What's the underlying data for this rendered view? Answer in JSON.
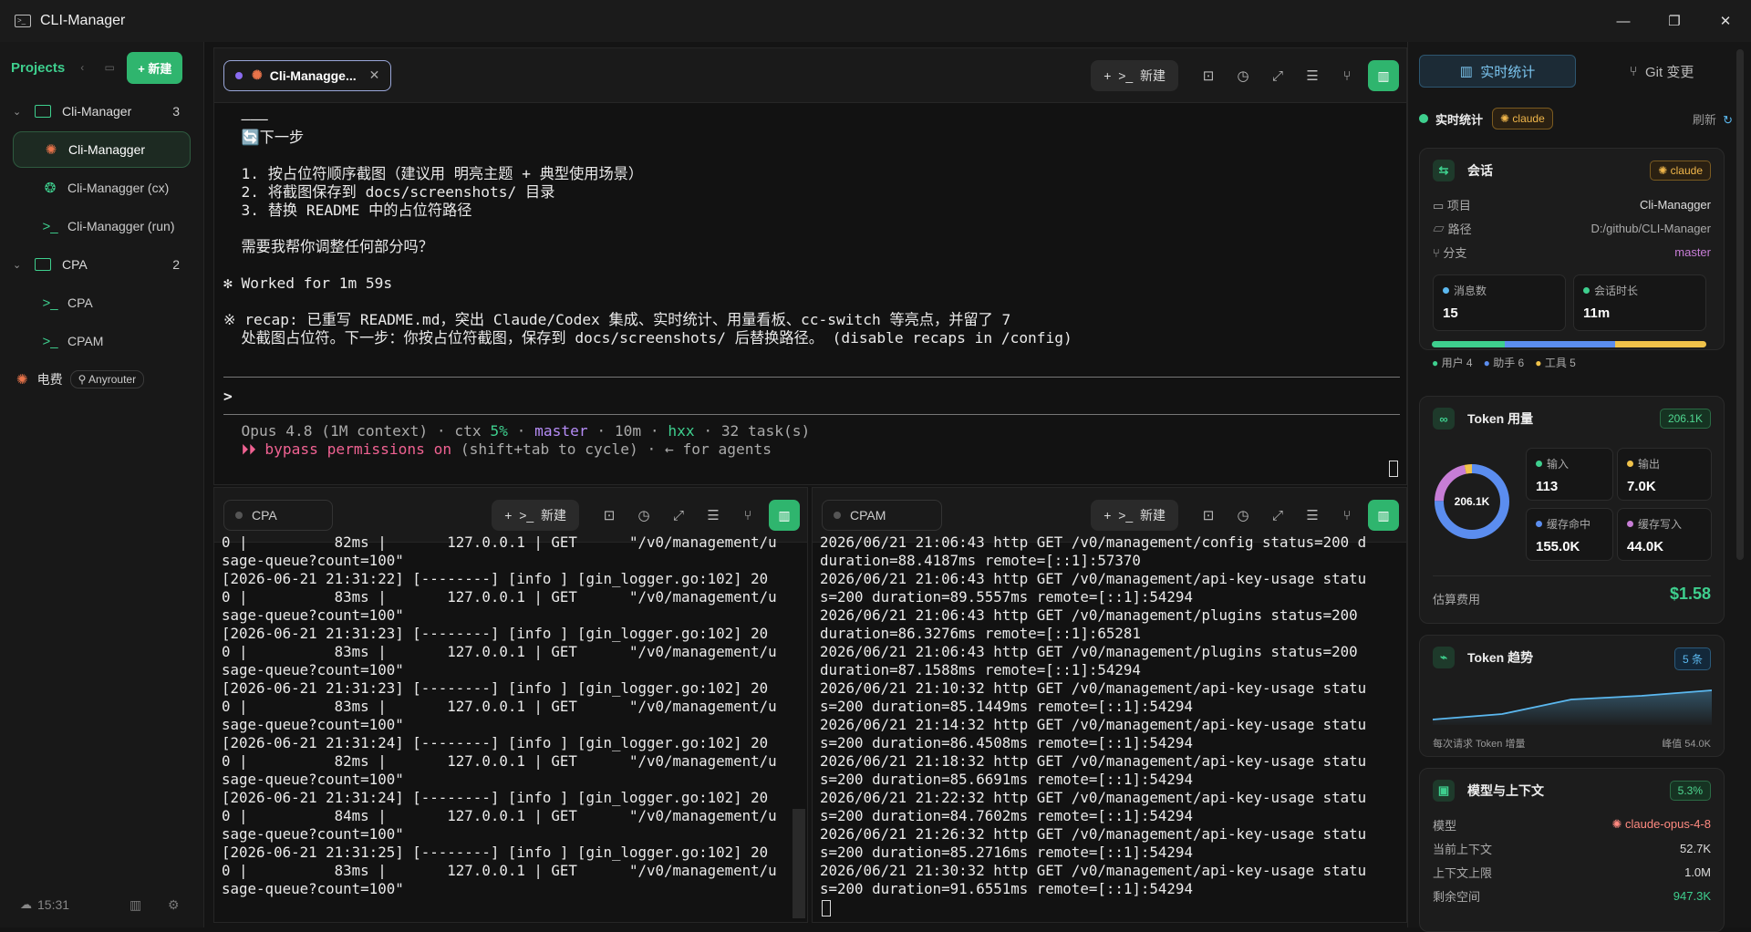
{
  "app": {
    "title": "CLI-Manager"
  },
  "sidebar": {
    "header_label": "Projects",
    "new_label": "+ 新建",
    "groups": [
      {
        "name": "Cli-Manager",
        "count": "3"
      },
      {
        "name": "CPA",
        "count": "2"
      }
    ],
    "items": [
      {
        "label": "Cli-Managger",
        "icon": "claude-icon"
      },
      {
        "label": "Cli-Managger (cx)",
        "icon": "openai-icon"
      },
      {
        "label": "Cli-Managger (run)",
        "icon": "terminal-icon"
      },
      {
        "label": "CPA",
        "icon": "terminal-icon"
      },
      {
        "label": "CPAM",
        "icon": "terminal-icon"
      }
    ],
    "extra_item": {
      "label": "电费",
      "tag": "Anyrouter"
    },
    "footer_time": "15:31"
  },
  "main_pane": {
    "tab_label": "Cli-Managge...",
    "new_label": "新建",
    "lines": [
      "  ———",
      "  🔄下一步",
      "",
      "  1. 按占位符顺序截图（建议用 明亮主题 + 典型使用场景）",
      "  2. 将截图保存到 docs/screenshots/ 目录",
      "  3. 替换 README 中的占位符路径",
      "",
      "  需要我帮你调整任何部分吗？",
      "",
      "✻ Worked for 1m 59s",
      "",
      "※ recap: 已重写 README.md，突出 Claude/Codex 集成、实时统计、用量看板、cc-switch 等亮点，并留了 7",
      "  处截图占位符。下一步：你按占位符截图，保存到 docs/screenshots/ 后替换路径。 (disable recaps in /config)"
    ],
    "prompt": ">",
    "status_line": "  Opus 4.8 (1M context) · ctx 5% · master · 10m · hxx · 32 task(s)",
    "bypass_line": "  ⏵⏵ bypass permissions on (shift+tab to cycle) · ← for agents"
  },
  "cpa_pane": {
    "tab_label": "CPA",
    "new_label": "新建",
    "lines": [
      "0 |          82ms |       127.0.0.1 | GET      \"/v0/management/u",
      "sage-queue?count=100\"",
      "[2026-06-21 21:31:22] [--------] [info ] [gin_logger.go:102] 20",
      "0 |          83ms |       127.0.0.1 | GET      \"/v0/management/u",
      "sage-queue?count=100\"",
      "[2026-06-21 21:31:23] [--------] [info ] [gin_logger.go:102] 20",
      "0 |          83ms |       127.0.0.1 | GET      \"/v0/management/u",
      "sage-queue?count=100\"",
      "[2026-06-21 21:31:23] [--------] [info ] [gin_logger.go:102] 20",
      "0 |          83ms |       127.0.0.1 | GET      \"/v0/management/u",
      "sage-queue?count=100\"",
      "[2026-06-21 21:31:24] [--------] [info ] [gin_logger.go:102] 20",
      "0 |          82ms |       127.0.0.1 | GET      \"/v0/management/u",
      "sage-queue?count=100\"",
      "[2026-06-21 21:31:24] [--------] [info ] [gin_logger.go:102] 20",
      "0 |          84ms |       127.0.0.1 | GET      \"/v0/management/u",
      "sage-queue?count=100\"",
      "[2026-06-21 21:31:25] [--------] [info ] [gin_logger.go:102] 20",
      "0 |          83ms |       127.0.0.1 | GET      \"/v0/management/u",
      "sage-queue?count=100\""
    ]
  },
  "cpam_pane": {
    "tab_label": "CPAM",
    "new_label": "新建",
    "lines": [
      "2026/06/21 21:06:43 http GET /v0/management/config status=200 d",
      "duration=88.4187ms remote=[::1]:57370",
      "2026/06/21 21:06:43 http GET /v0/management/api-key-usage statu",
      "s=200 duration=89.5557ms remote=[::1]:54294",
      "2026/06/21 21:06:43 http GET /v0/management/plugins status=200",
      "duration=86.3276ms remote=[::1]:65281",
      "2026/06/21 21:06:43 http GET /v0/management/plugins status=200",
      "duration=87.1588ms remote=[::1]:54294",
      "2026/06/21 21:10:32 http GET /v0/management/api-key-usage statu",
      "s=200 duration=85.1449ms remote=[::1]:54294",
      "2026/06/21 21:14:32 http GET /v0/management/api-key-usage statu",
      "s=200 duration=86.4508ms remote=[::1]:54294",
      "2026/06/21 21:18:32 http GET /v0/management/api-key-usage statu",
      "s=200 duration=85.6691ms remote=[::1]:54294",
      "2026/06/21 21:22:32 http GET /v0/management/api-key-usage statu",
      "s=200 duration=84.7602ms remote=[::1]:54294",
      "2026/06/21 21:26:32 http GET /v0/management/api-key-usage statu",
      "s=200 duration=85.2716ms remote=[::1]:54294",
      "2026/06/21 21:30:32 http GET /v0/management/api-key-usage statu",
      "s=200 duration=91.6551ms remote=[::1]:54294"
    ]
  },
  "right": {
    "tab_stats": "实时统计",
    "tab_git": "Git 变更",
    "status_label": "实时统计",
    "status_chip": "claude",
    "refresh_label": "刷新",
    "session": {
      "title": "会话",
      "badge": "claude",
      "rows": [
        {
          "k": "项目",
          "v": "Cli-Managger"
        },
        {
          "k": "路径",
          "v": "D:/github/CLI-Manager"
        },
        {
          "k": "分支",
          "v": "master"
        }
      ],
      "msg_label": "消息数",
      "msg_value": "15",
      "dur_label": "会话时长",
      "dur_value": "11m",
      "legend": [
        "用户 4",
        "助手 6",
        "工具 5"
      ],
      "split": [
        4,
        6,
        5
      ]
    },
    "token": {
      "title": "Token 用量",
      "badge": "206.1K",
      "center": "206.1K",
      "input_label": "输入",
      "input_value": "113",
      "output_label": "输出",
      "output_value": "7.0K",
      "cache_hit_label": "缓存命中",
      "cache_hit_value": "155.0K",
      "cache_write_label": "缓存写入",
      "cache_write_value": "44.0K",
      "cost_label": "估算费用",
      "cost_value": "$1.58"
    },
    "trend": {
      "title": "Token 趋势",
      "badge": "5 条",
      "caption": "每次请求 Token 增量",
      "peak": "峰值 54.0K"
    },
    "model": {
      "title": "模型与上下文",
      "badge": "5.3%",
      "rows": [
        {
          "k": "模型",
          "v": "claude-opus-4-8"
        },
        {
          "k": "当前上下文",
          "v": "52.7K"
        },
        {
          "k": "上下文上限",
          "v": "1.0M"
        },
        {
          "k": "剩余空间",
          "v": "947.3K"
        }
      ]
    }
  }
}
